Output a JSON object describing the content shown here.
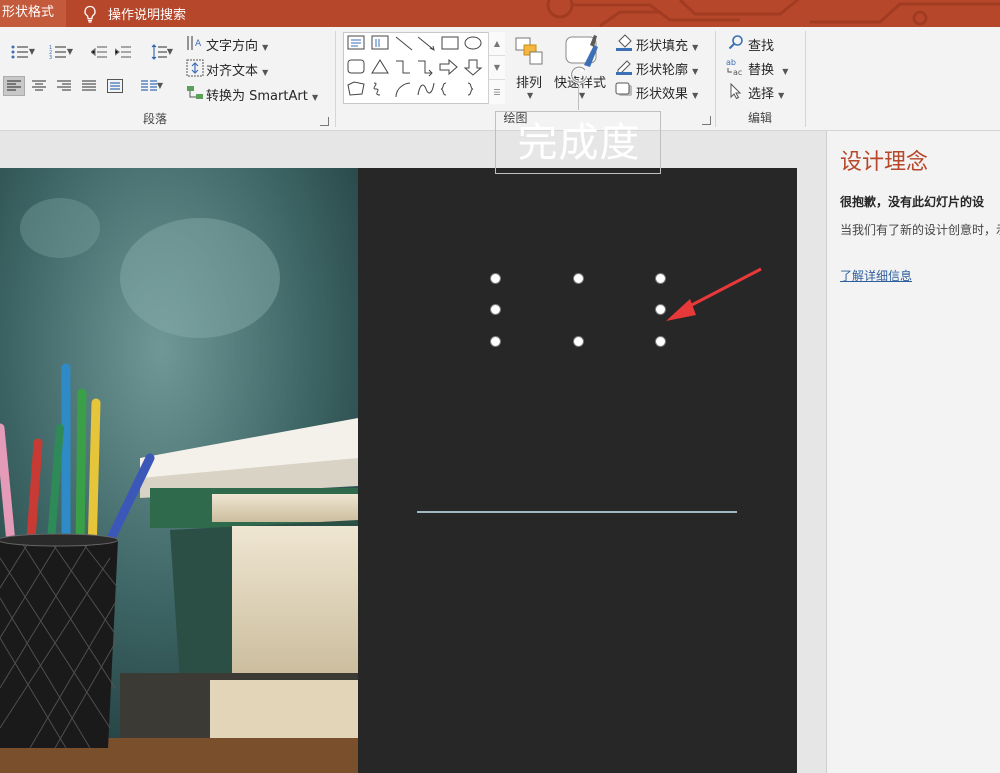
{
  "tabbar": {
    "active_tab": "形状格式",
    "tell_me": "操作说明搜索"
  },
  "ribbon": {
    "paragraph": {
      "label": "段落",
      "text_direction": "文字方向",
      "align_text": "对齐文本",
      "convert_smartart": "转换为 SmartArt"
    },
    "drawing": {
      "label": "绘图",
      "arrange": "排列",
      "quick_styles": "快速样式",
      "shape_fill": "形状填充",
      "shape_outline": "形状轮廓",
      "shape_effects": "形状效果"
    },
    "editing": {
      "label": "编辑",
      "find": "查找",
      "replace": "替换",
      "select": "选择"
    }
  },
  "slide": {
    "textbox_text": "完成度"
  },
  "design_pane": {
    "title": "设计理念",
    "sorry": "很抱歉，没有此幻灯片的设",
    "body": "当我们有了新的设计创意时，示。",
    "link": "了解详细信息"
  },
  "colors": {
    "accent": "#b7472a",
    "slide_bg": "#272727",
    "rule": "#9fb8c2",
    "arrow": "#e8393a",
    "link": "#2e5f9c"
  }
}
